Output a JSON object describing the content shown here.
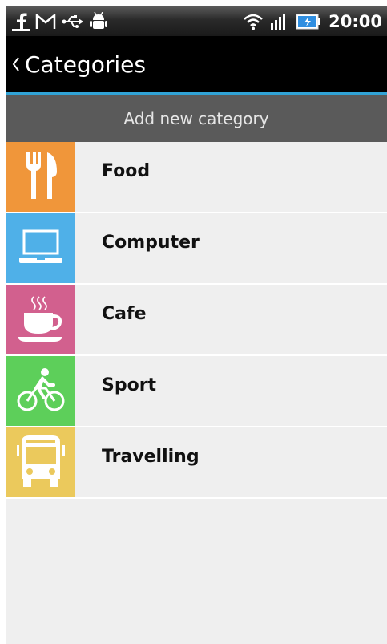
{
  "status_bar": {
    "time": "20:00",
    "left_icons": [
      "facebook-icon",
      "gmail-icon",
      "usb-icon",
      "android-debug-icon"
    ],
    "right_icons": [
      "wifi-icon",
      "signal-icon",
      "battery-charging-icon"
    ]
  },
  "action_bar": {
    "title": "Categories",
    "back_icon": "chevron-left-icon"
  },
  "add_button": {
    "label": "Add new category"
  },
  "categories": [
    {
      "label": "Food",
      "icon": "fork-knife-icon",
      "color": "#f0963a"
    },
    {
      "label": "Computer",
      "icon": "laptop-icon",
      "color": "#4fb0e8"
    },
    {
      "label": "Cafe",
      "icon": "coffee-cup-icon",
      "color": "#d2608e"
    },
    {
      "label": "Sport",
      "icon": "cyclist-icon",
      "color": "#5dcf5a"
    },
    {
      "label": "Travelling",
      "icon": "bus-icon",
      "color": "#ebc95c"
    }
  ],
  "colors": {
    "accent": "#31a3d6",
    "action_bar": "#000000",
    "add_button_bg": "#5a5a5a",
    "list_bg": "#efefef"
  }
}
